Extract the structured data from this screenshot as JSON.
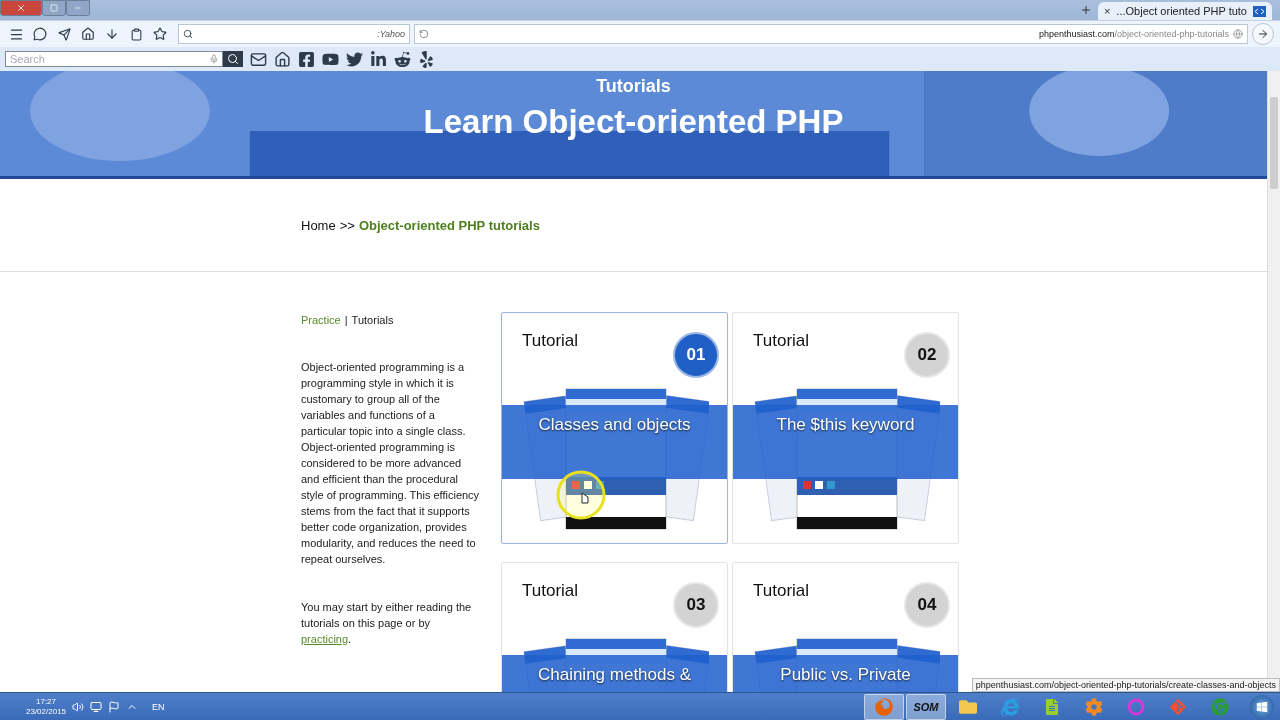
{
  "browser": {
    "tab": {
      "title": "...Object oriented PHP tuto",
      "close": "×"
    },
    "search_engine": ":Yahoo",
    "address": {
      "host": "phpenthusiast.com",
      "path": "/object-oriented-php-tutorials"
    },
    "toolbar_search": {
      "placeholder": "Search"
    }
  },
  "page": {
    "banner": {
      "kicker": "Tutorials",
      "title": "Learn Object-oriented PHP"
    },
    "breadcrumb": {
      "home": "Home",
      "separator": ">>",
      "current": "Object-oriented PHP tutorials"
    },
    "side_nav": {
      "separator": "|",
      "items": [
        {
          "label": "Practice",
          "selected": false
        },
        {
          "label": "Tutorials",
          "selected": true
        }
      ]
    },
    "intro": "Object-oriented programming is a programming style in which it is customary to group all of the variables and functions of a particular topic into a single class. Object-oriented programming is considered to be more advanced and efficient than the procedural style of programming. This efficiency stems from the fact that it supports better code organization, provides modularity, and reduces the need to repeat ourselves.",
    "start_note": {
      "text": "You may start by either reading the tutorials on this page or by",
      "link": "practicing",
      "end": "."
    },
    "cards": [
      {
        "label": "Tutorial",
        "number": "01",
        "title": "Classes and objects",
        "selected": true
      },
      {
        "label": "Tutorial",
        "number": "02",
        "title": "The $this keyword",
        "selected": false
      },
      {
        "label": "Tutorial",
        "number": "03",
        "title": "Chaining methods &",
        "selected": false
      },
      {
        "label": "Tutorial",
        "number": "04",
        "title": "Public vs. Private",
        "selected": false
      }
    ]
  },
  "status_url": "phpenthusiast.com/object-oriented-php-tutorials/create-classes-and-objects",
  "taskbar": {
    "time": "17:27",
    "date": "23/02/2015",
    "language": "EN",
    "apps": [
      {
        "kind": "firefox",
        "active": true
      },
      {
        "kind": "som",
        "label": "SOM",
        "active": true
      },
      {
        "kind": "folder",
        "active": false
      },
      {
        "kind": "ie",
        "active": false
      },
      {
        "kind": "notepad",
        "active": false
      },
      {
        "kind": "gear",
        "active": false
      },
      {
        "kind": "wamp",
        "active": false
      },
      {
        "kind": "git",
        "active": false
      },
      {
        "kind": "chrome",
        "active": false
      }
    ]
  }
}
